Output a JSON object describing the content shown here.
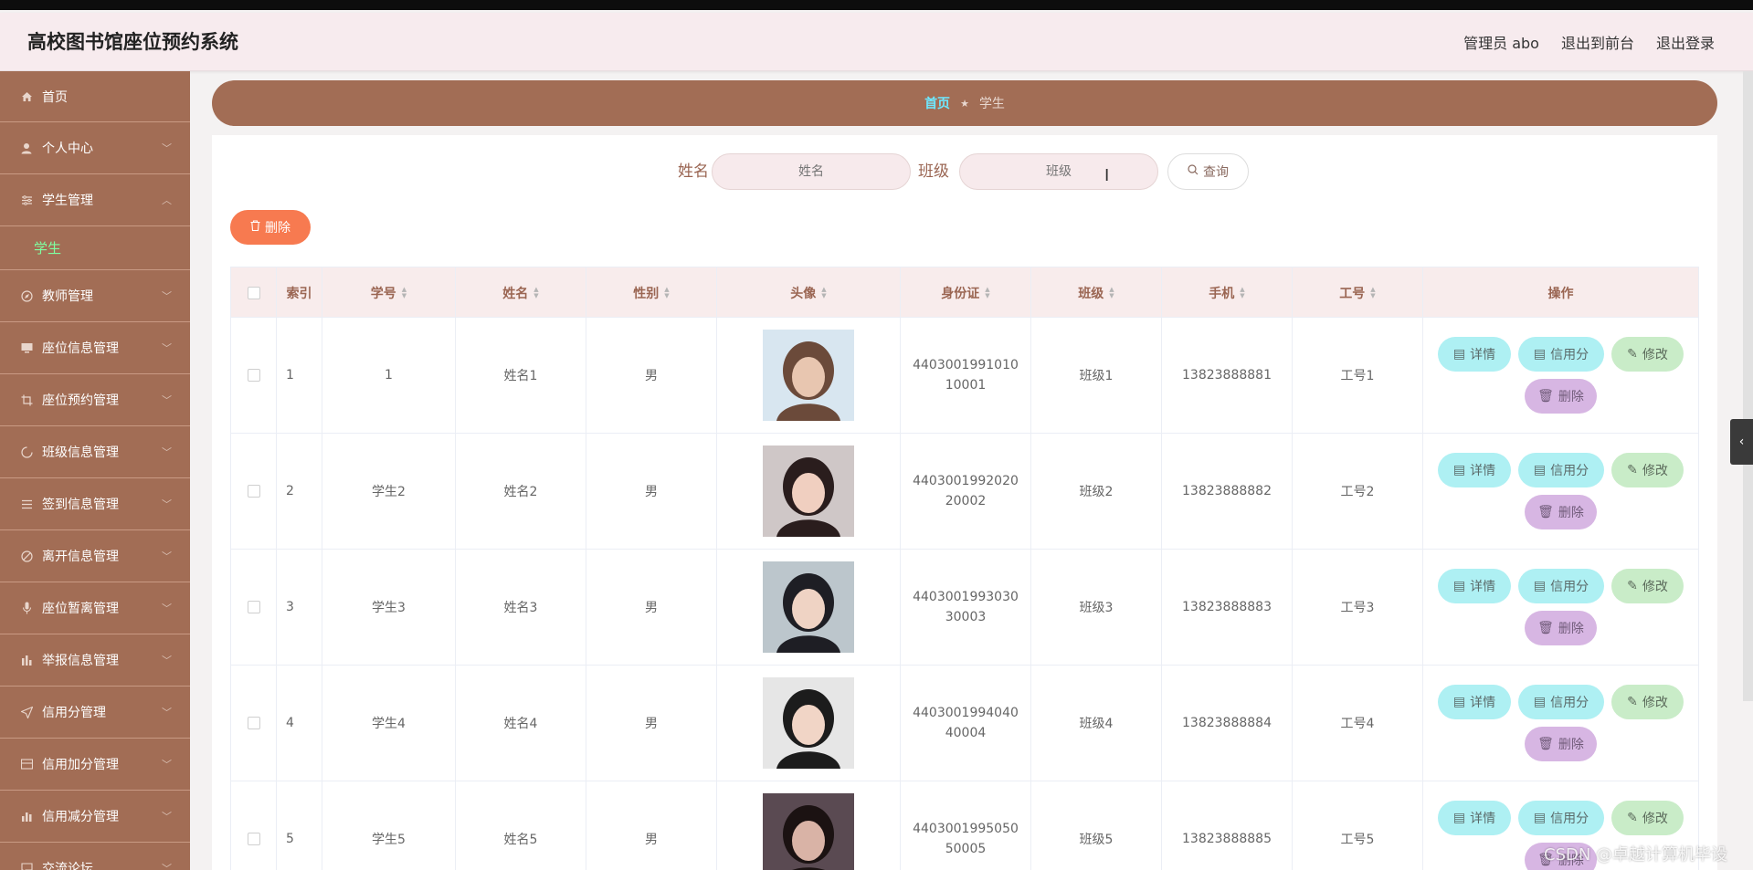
{
  "app": {
    "title": "高校图书馆座位预约系统"
  },
  "header": {
    "admin_label": "管理员 abo",
    "front_label": "退出到前台",
    "logout_label": "退出登录"
  },
  "sidebar": {
    "items": [
      {
        "label": "首页",
        "icon": "home-icon"
      },
      {
        "label": "个人中心",
        "icon": "user-icon"
      },
      {
        "label": "学生管理",
        "icon": "sliders-icon",
        "expanded": true,
        "sub": "学生"
      },
      {
        "label": "教师管理",
        "icon": "compass-icon"
      },
      {
        "label": "座位信息管理",
        "icon": "monitor-icon"
      },
      {
        "label": "座位预约管理",
        "icon": "crop-icon"
      },
      {
        "label": "班级信息管理",
        "icon": "loading-icon"
      },
      {
        "label": "签到信息管理",
        "icon": "list-icon"
      },
      {
        "label": "离开信息管理",
        "icon": "no-entry-icon"
      },
      {
        "label": "座位暂离管理",
        "icon": "microphone-icon"
      },
      {
        "label": "举报信息管理",
        "icon": "bar-chart-icon"
      },
      {
        "label": "信用分管理",
        "icon": "send-icon"
      },
      {
        "label": "信用加分管理",
        "icon": "wallet-icon"
      },
      {
        "label": "信用减分管理",
        "icon": "stats-icon"
      },
      {
        "label": "交流论坛",
        "icon": "chat-icon"
      }
    ]
  },
  "breadcrumb": {
    "home": "首页",
    "current": "学生"
  },
  "search": {
    "name_label": "姓名",
    "name_placeholder": "姓名",
    "class_label": "班级",
    "class_placeholder": "班级",
    "button": "查询"
  },
  "toolbar": {
    "delete_label": "删除"
  },
  "table": {
    "columns": [
      "索引",
      "学号",
      "姓名",
      "性别",
      "头像",
      "身份证",
      "班级",
      "手机",
      "工号",
      "操作"
    ],
    "rows": [
      {
        "index": "1",
        "student_no": "1",
        "name": "姓名1",
        "gender": "男",
        "id_card": "440300199101010001",
        "class": "班级1",
        "phone": "13823888881",
        "work_no": "工号1"
      },
      {
        "index": "2",
        "student_no": "学生2",
        "name": "姓名2",
        "gender": "男",
        "id_card": "440300199202020002",
        "class": "班级2",
        "phone": "13823888882",
        "work_no": "工号2"
      },
      {
        "index": "3",
        "student_no": "学生3",
        "name": "姓名3",
        "gender": "男",
        "id_card": "440300199303030003",
        "class": "班级3",
        "phone": "13823888883",
        "work_no": "工号3"
      },
      {
        "index": "4",
        "student_no": "学生4",
        "name": "姓名4",
        "gender": "男",
        "id_card": "440300199404040004",
        "class": "班级4",
        "phone": "13823888884",
        "work_no": "工号4"
      },
      {
        "index": "5",
        "student_no": "学生5",
        "name": "姓名5",
        "gender": "男",
        "id_card": "440300199505050005",
        "class": "班级5",
        "phone": "13823888885",
        "work_no": "工号5"
      }
    ],
    "actions": {
      "detail": "详情",
      "credit": "信用分",
      "edit": "修改",
      "delete": "删除"
    }
  },
  "watermark": "CSDN @卓越计算机毕设",
  "colors": {
    "sidebar": "#a26d55",
    "header": "#f7ebee",
    "accent": "#6ee8ff",
    "delete": "#f77a50"
  }
}
